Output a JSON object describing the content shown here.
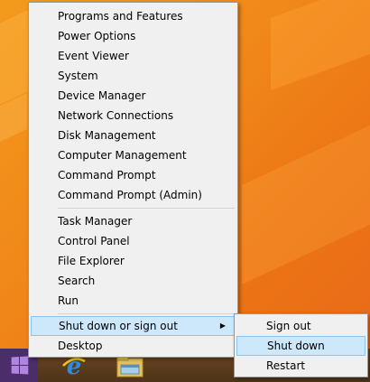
{
  "menu": {
    "group1": [
      "Programs and Features",
      "Power Options",
      "Event Viewer",
      "System",
      "Device Manager",
      "Network Connections",
      "Disk Management",
      "Computer Management",
      "Command Prompt",
      "Command Prompt (Admin)"
    ],
    "group2": [
      "Task Manager",
      "Control Panel",
      "File Explorer",
      "Search",
      "Run"
    ],
    "shutdown_label": "Shut down or sign out",
    "desktop_label": "Desktop"
  },
  "submenu": {
    "items": [
      "Sign out",
      "Shut down",
      "Restart"
    ],
    "highlighted": "Shut down"
  },
  "taskbar": {
    "icons": [
      "windows-logo-icon",
      "internet-explorer-icon",
      "file-explorer-icon"
    ]
  },
  "colors": {
    "desktop_orange": "#f0871a",
    "menu_background": "#f0f0f0",
    "highlight": "#cde8fb",
    "highlight_border": "#8ec3ee",
    "start_button": "#4b2d6b"
  }
}
